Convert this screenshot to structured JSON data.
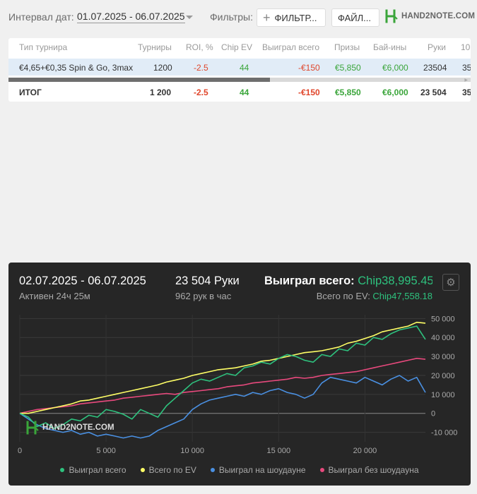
{
  "toolbar": {
    "date_label": "Интервал дат:",
    "date_range": "01.07.2025 - 06.07.2025",
    "filters_label": "Фильтры:",
    "filter_button": "ФИЛЬТР...",
    "file_button": "ФАЙЛ...",
    "logo_text": "HAND2NOTE.COM"
  },
  "table": {
    "headers": [
      "Тип турнира",
      "Турниры",
      "ROI, %",
      "Chip EV",
      "Выиграл всего",
      "Призы",
      "Бай-ины",
      "Руки",
      "10"
    ],
    "rows": [
      [
        "€4,65+€0,35 Spin & Go, 3max",
        "1200",
        "-2.5",
        "44",
        "-€150",
        "€5,850",
        "€6,000",
        "23504",
        "35"
      ]
    ],
    "total": [
      "ИТОГ",
      "1 200",
      "-2.5",
      "44",
      "-€150",
      "€5,850",
      "€6,000",
      "23 504",
      "35"
    ]
  },
  "graph": {
    "date_range": "02.07.2025 - 06.07.2025",
    "active": "Активен 24ч 25м",
    "hands": "23 504 Руки",
    "per_hour": "962 рук в час",
    "won_label": "Выиграл всего: ",
    "won_value": "Chip38,995.45",
    "ev_label": "Всего по EV: ",
    "ev_value": "Chip47,558.18",
    "watermark": "HAND2NOTE.COM",
    "settings_icon": "gear-icon"
  },
  "chart_data": {
    "type": "line",
    "xlabel": "",
    "ylabel": "",
    "xlim": [
      0,
      23504
    ],
    "ylim": [
      -15000,
      52000
    ],
    "x_ticks": [
      0,
      5000,
      10000,
      15000,
      20000
    ],
    "x_tick_labels": [
      "0",
      "5 000",
      "10 000",
      "15 000",
      "20 000"
    ],
    "y_ticks": [
      -10000,
      0,
      10000,
      20000,
      30000,
      40000,
      50000
    ],
    "y_tick_labels": [
      "-10 000",
      "0",
      "10 000",
      "20 000",
      "30 000",
      "40 000",
      "50 000"
    ],
    "grid": true,
    "legend_position": "bottom",
    "series": [
      {
        "name": "Выиграл всего",
        "color": "#2ec27e",
        "x": [
          0,
          500,
          1000,
          1500,
          2000,
          2500,
          3000,
          3500,
          4000,
          4500,
          5000,
          5500,
          6000,
          6500,
          7000,
          7500,
          8000,
          8500,
          9000,
          9500,
          10000,
          10500,
          11000,
          11500,
          12000,
          12500,
          13000,
          13500,
          14000,
          14500,
          15000,
          15500,
          16000,
          16500,
          17000,
          17500,
          18000,
          18500,
          19000,
          19500,
          20000,
          20500,
          21000,
          21500,
          22000,
          22500,
          23000,
          23504
        ],
        "y": [
          0,
          -2000,
          -7000,
          -5000,
          -8000,
          -6000,
          -3000,
          -4000,
          -1000,
          -2000,
          2000,
          1000,
          -500,
          -3000,
          2000,
          0,
          -2000,
          4000,
          8000,
          12000,
          16000,
          18000,
          17000,
          19000,
          21000,
          20000,
          24000,
          25000,
          27000,
          26000,
          29000,
          31000,
          30000,
          28000,
          27000,
          31000,
          30000,
          34000,
          33000,
          37000,
          36000,
          40000,
          39000,
          42000,
          44000,
          45000,
          46000,
          39000
        ]
      },
      {
        "name": "Всего по EV",
        "color": "#ffff66",
        "x": [
          0,
          500,
          1000,
          1500,
          2000,
          2500,
          3000,
          3500,
          4000,
          4500,
          5000,
          5500,
          6000,
          6500,
          7000,
          7500,
          8000,
          8500,
          9000,
          9500,
          10000,
          10500,
          11000,
          11500,
          12000,
          12500,
          13000,
          13500,
          14000,
          14500,
          15000,
          15500,
          16000,
          16500,
          17000,
          17500,
          18000,
          18500,
          19000,
          19500,
          20000,
          20500,
          21000,
          21500,
          22000,
          22500,
          23000,
          23504
        ],
        "y": [
          0,
          0,
          1000,
          2000,
          3000,
          4000,
          5000,
          6500,
          7000,
          8000,
          9000,
          10000,
          11000,
          12000,
          13000,
          14000,
          15000,
          16500,
          17500,
          18500,
          20000,
          21000,
          22000,
          23000,
          23500,
          24000,
          25000,
          26000,
          27500,
          28000,
          29000,
          30000,
          31000,
          32000,
          32500,
          33000,
          34000,
          35000,
          37000,
          38000,
          39500,
          41000,
          43000,
          44000,
          45000,
          46000,
          48000,
          47558
        ]
      },
      {
        "name": "Выиграл на шоудауне",
        "color": "#4a90e2",
        "x": [
          0,
          500,
          1000,
          1500,
          2000,
          2500,
          3000,
          3500,
          4000,
          4500,
          5000,
          5500,
          6000,
          6500,
          7000,
          7500,
          8000,
          8500,
          9000,
          9500,
          10000,
          10500,
          11000,
          11500,
          12000,
          12500,
          13000,
          13500,
          14000,
          14500,
          15000,
          15500,
          16000,
          16500,
          17000,
          17500,
          18000,
          18500,
          19000,
          19500,
          20000,
          20500,
          21000,
          21500,
          22000,
          22500,
          23000,
          23504
        ],
        "y": [
          0,
          -3000,
          -6000,
          -8000,
          -9000,
          -10000,
          -9000,
          -11000,
          -10000,
          -12000,
          -11000,
          -12000,
          -13000,
          -12000,
          -13000,
          -12000,
          -9000,
          -7000,
          -5000,
          -3000,
          2000,
          5000,
          7000,
          8000,
          9000,
          10000,
          9000,
          11000,
          10000,
          12000,
          13000,
          11000,
          10000,
          8000,
          10000,
          16000,
          19000,
          18000,
          17000,
          16000,
          19000,
          17000,
          15000,
          18000,
          20000,
          17000,
          19000,
          11000
        ]
      },
      {
        "name": "Выиграл без шоудауна",
        "color": "#e8497d",
        "x": [
          0,
          500,
          1000,
          1500,
          2000,
          2500,
          3000,
          3500,
          4000,
          4500,
          5000,
          5500,
          6000,
          6500,
          7000,
          7500,
          8000,
          8500,
          9000,
          9500,
          10000,
          10500,
          11000,
          11500,
          12000,
          12500,
          13000,
          13500,
          14000,
          14500,
          15000,
          15500,
          16000,
          16500,
          17000,
          17500,
          18000,
          18500,
          19000,
          19500,
          20000,
          20500,
          21000,
          21500,
          22000,
          22500,
          23000,
          23504
        ],
        "y": [
          0,
          1000,
          2000,
          2500,
          3000,
          3500,
          4000,
          5000,
          5500,
          6000,
          6500,
          7000,
          8000,
          8500,
          9000,
          9500,
          10000,
          10500,
          10000,
          11000,
          11500,
          12000,
          12500,
          13000,
          14000,
          14500,
          15000,
          16000,
          16500,
          17000,
          17500,
          18000,
          19000,
          18500,
          19000,
          20000,
          20500,
          21000,
          21500,
          22000,
          23000,
          24000,
          25000,
          26000,
          27000,
          28000,
          29000,
          28500
        ]
      }
    ]
  }
}
